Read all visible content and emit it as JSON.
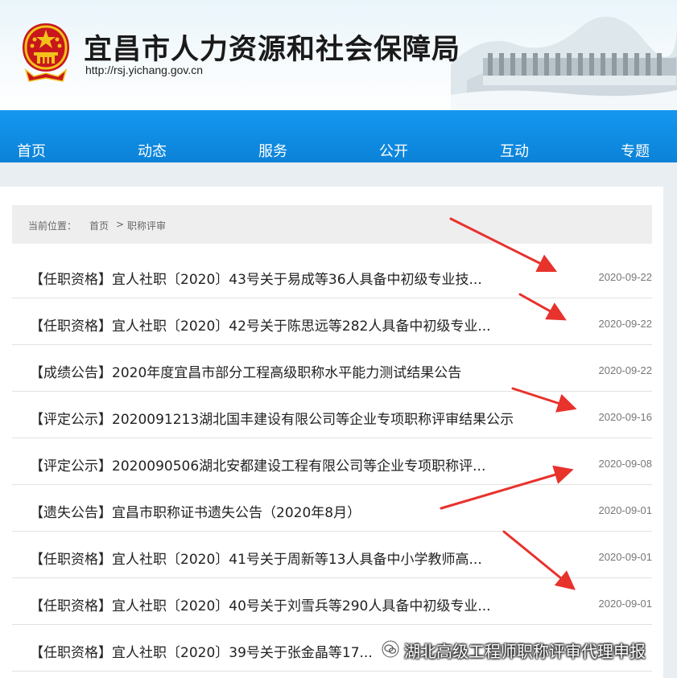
{
  "header": {
    "title": "宜昌市人力资源和社会保障局",
    "url": "http://rsj.yichang.gov.cn"
  },
  "nav": {
    "items": [
      "首页",
      "动态",
      "服务",
      "公开",
      "互动",
      "专题"
    ]
  },
  "breadcrumb": {
    "prefix": "当前位置：",
    "home": "首页",
    "separator": ">",
    "current": "职称评审"
  },
  "list": [
    {
      "title": "【任职资格】宜人社职〔2020〕43号关于易成等36人具备中初级专业技...",
      "date": "2020-09-22"
    },
    {
      "title": "【任职资格】宜人社职〔2020〕42号关于陈思远等282人具备中初级专业...",
      "date": "2020-09-22"
    },
    {
      "title": "【成绩公告】2020年度宜昌市部分工程高级职称水平能力测试结果公告",
      "date": "2020-09-22"
    },
    {
      "title": "【评定公示】2020091213湖北国丰建设有限公司等企业专项职称评审结果公示",
      "date": "2020-09-16"
    },
    {
      "title": "【评定公示】2020090506湖北安都建设工程有限公司等企业专项职称评...",
      "date": "2020-09-08"
    },
    {
      "title": "【遗失公告】宜昌市职称证书遗失公告（2020年8月）",
      "date": "2020-09-01"
    },
    {
      "title": "【任职资格】宜人社职〔2020〕41号关于周新等13人具备中小学教师高...",
      "date": "2020-09-01"
    },
    {
      "title": "【任职资格】宜人社职〔2020〕40号关于刘雪兵等290人具备中初级专业...",
      "date": "2020-09-01"
    },
    {
      "title": "【任职资格】宜人社职〔2020〕39号关于张金晶等17...",
      "date": ""
    }
  ],
  "watermark": {
    "text": "湖北高级工程师职称评审代理申报"
  },
  "colors": {
    "nav_blue": "#0b82d8",
    "arrow_red": "#e8322c",
    "emblem_red": "#c8161d",
    "emblem_gold": "#f2c21a"
  }
}
